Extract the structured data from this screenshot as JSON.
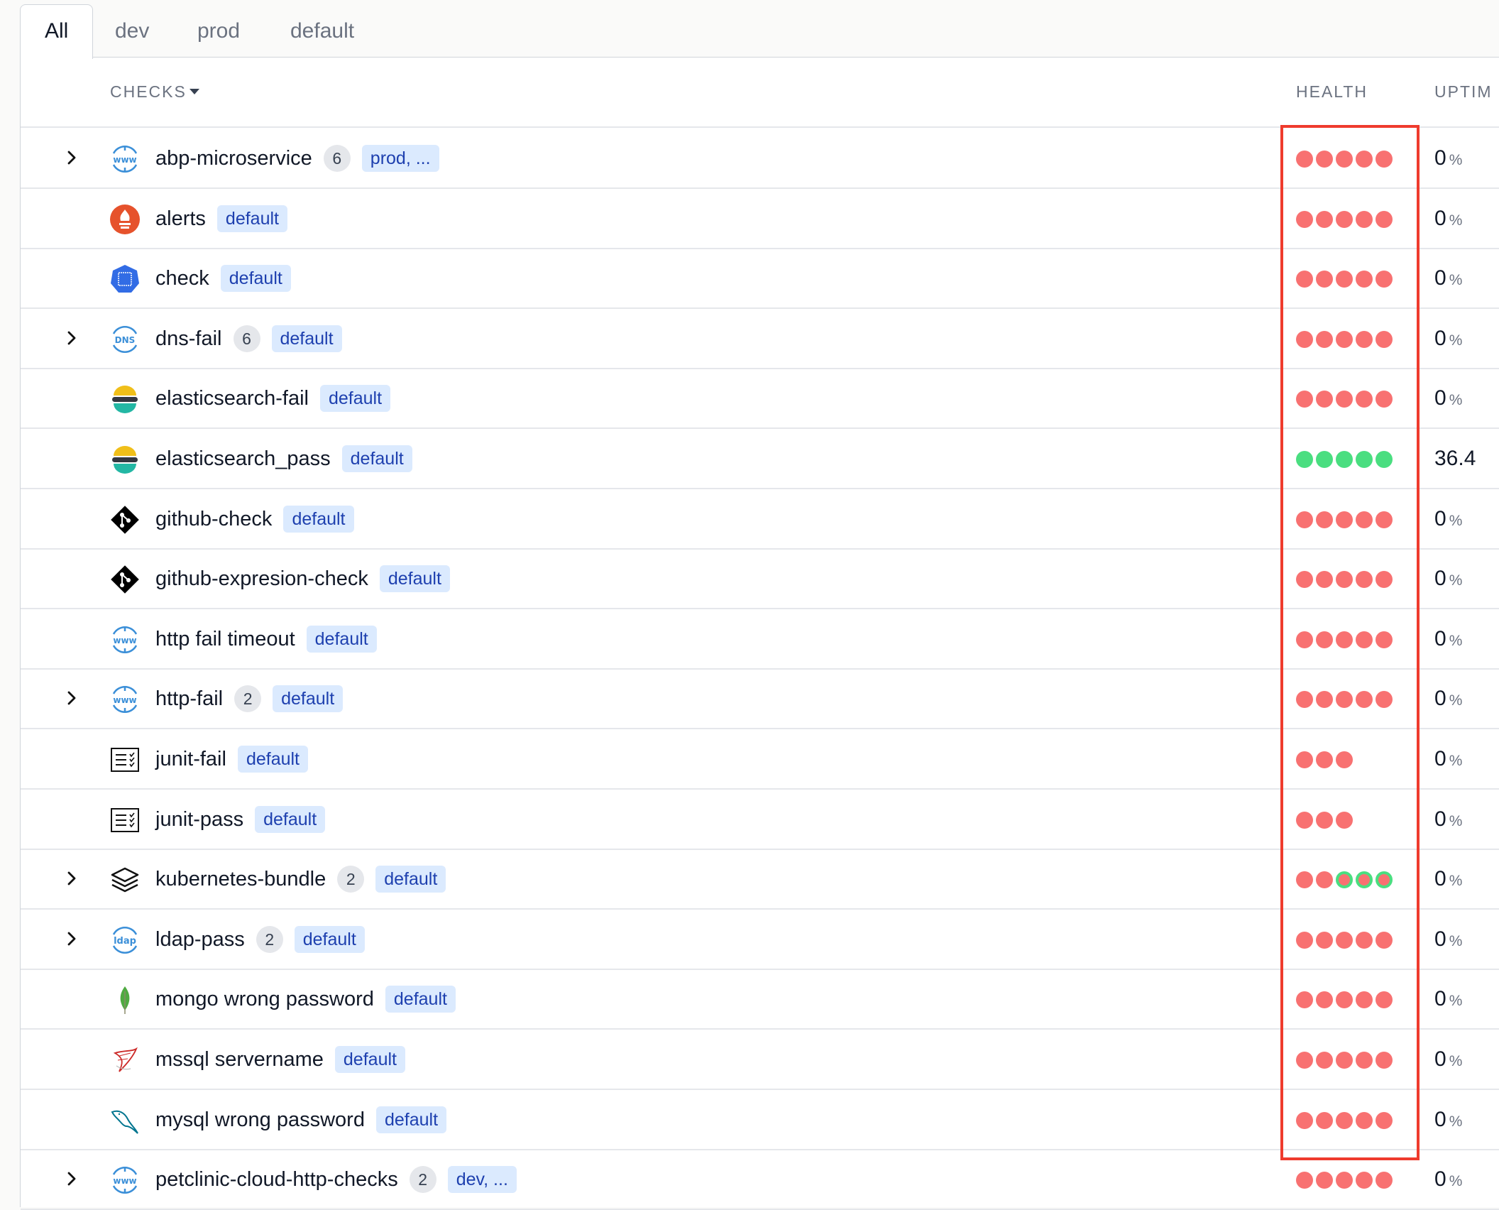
{
  "tabs": [
    "All",
    "dev",
    "prod",
    "default"
  ],
  "columns": {
    "checks": "CHECKS",
    "health": "HEALTH",
    "uptime": "UPTIM"
  },
  "colors": {
    "fail": "#f87171",
    "pass": "#4ade80",
    "highlight": "#ef3b2d",
    "tag_bg": "#dbeafe",
    "tag_text": "#1e40af"
  },
  "rows": [
    {
      "name": "abp-microservice",
      "icon": "www-icon",
      "expandable": true,
      "count": "6",
      "tag": "prod, ...",
      "health": [
        "fail",
        "fail",
        "fail",
        "fail",
        "fail"
      ],
      "uptime": "0",
      "unit": "%"
    },
    {
      "name": "alerts",
      "icon": "prometheus-icon",
      "expandable": false,
      "count": "",
      "tag": "default",
      "health": [
        "fail",
        "fail",
        "fail",
        "fail",
        "fail"
      ],
      "uptime": "0",
      "unit": "%"
    },
    {
      "name": "check",
      "icon": "kubernetes-icon",
      "expandable": false,
      "count": "",
      "tag": "default",
      "health": [
        "fail",
        "fail",
        "fail",
        "fail",
        "fail"
      ],
      "uptime": "0",
      "unit": "%"
    },
    {
      "name": "dns-fail",
      "icon": "dns-icon",
      "expandable": true,
      "count": "6",
      "tag": "default",
      "health": [
        "fail",
        "fail",
        "fail",
        "fail",
        "fail"
      ],
      "uptime": "0",
      "unit": "%"
    },
    {
      "name": "elasticsearch-fail",
      "icon": "elasticsearch-icon",
      "expandable": false,
      "count": "",
      "tag": "default",
      "health": [
        "fail",
        "fail",
        "fail",
        "fail",
        "fail"
      ],
      "uptime": "0",
      "unit": "%"
    },
    {
      "name": "elasticsearch_pass",
      "icon": "elasticsearch-icon",
      "expandable": false,
      "count": "",
      "tag": "default",
      "health": [
        "pass",
        "pass",
        "pass",
        "pass",
        "pass"
      ],
      "uptime": "36.4",
      "unit": ""
    },
    {
      "name": "github-check",
      "icon": "git-icon",
      "expandable": false,
      "count": "",
      "tag": "default",
      "health": [
        "fail",
        "fail",
        "fail",
        "fail",
        "fail"
      ],
      "uptime": "0",
      "unit": "%"
    },
    {
      "name": "github-expresion-check",
      "icon": "git-icon",
      "expandable": false,
      "count": "",
      "tag": "default",
      "health": [
        "fail",
        "fail",
        "fail",
        "fail",
        "fail"
      ],
      "uptime": "0",
      "unit": "%"
    },
    {
      "name": "http fail timeout",
      "icon": "www-icon",
      "expandable": false,
      "count": "",
      "tag": "default",
      "health": [
        "fail",
        "fail",
        "fail",
        "fail",
        "fail"
      ],
      "uptime": "0",
      "unit": "%"
    },
    {
      "name": "http-fail",
      "icon": "www-icon",
      "expandable": true,
      "count": "2",
      "tag": "default",
      "health": [
        "fail",
        "fail",
        "fail",
        "fail",
        "fail"
      ],
      "uptime": "0",
      "unit": "%"
    },
    {
      "name": "junit-fail",
      "icon": "junit-icon",
      "expandable": false,
      "count": "",
      "tag": "default",
      "health": [
        "fail",
        "fail",
        "fail"
      ],
      "uptime": "0",
      "unit": "%"
    },
    {
      "name": "junit-pass",
      "icon": "junit-icon",
      "expandable": false,
      "count": "",
      "tag": "default",
      "health": [
        "fail",
        "fail",
        "fail"
      ],
      "uptime": "0",
      "unit": "%"
    },
    {
      "name": "kubernetes-bundle",
      "icon": "layers-icon",
      "expandable": true,
      "count": "2",
      "tag": "default",
      "health": [
        "fail",
        "fail",
        "mixed",
        "mixed",
        "mixed"
      ],
      "uptime": "0",
      "unit": "%"
    },
    {
      "name": "ldap-pass",
      "icon": "ldap-icon",
      "expandable": true,
      "count": "2",
      "tag": "default",
      "health": [
        "fail",
        "fail",
        "fail",
        "fail",
        "fail"
      ],
      "uptime": "0",
      "unit": "%"
    },
    {
      "name": "mongo wrong password",
      "icon": "mongodb-icon",
      "expandable": false,
      "count": "",
      "tag": "default",
      "health": [
        "fail",
        "fail",
        "fail",
        "fail",
        "fail"
      ],
      "uptime": "0",
      "unit": "%"
    },
    {
      "name": "mssql servername",
      "icon": "mssql-icon",
      "expandable": false,
      "count": "",
      "tag": "default",
      "health": [
        "fail",
        "fail",
        "fail",
        "fail",
        "fail"
      ],
      "uptime": "0",
      "unit": "%"
    },
    {
      "name": "mysql wrong password",
      "icon": "mysql-icon",
      "expandable": false,
      "count": "",
      "tag": "default",
      "health": [
        "fail",
        "fail",
        "fail",
        "fail",
        "fail"
      ],
      "uptime": "0",
      "unit": "%"
    },
    {
      "name": "petclinic-cloud-http-checks",
      "icon": "www-icon",
      "expandable": true,
      "count": "2",
      "tag": "dev, ...",
      "health": [
        "fail",
        "fail",
        "fail",
        "fail",
        "fail"
      ],
      "uptime": "0",
      "unit": "%"
    }
  ]
}
